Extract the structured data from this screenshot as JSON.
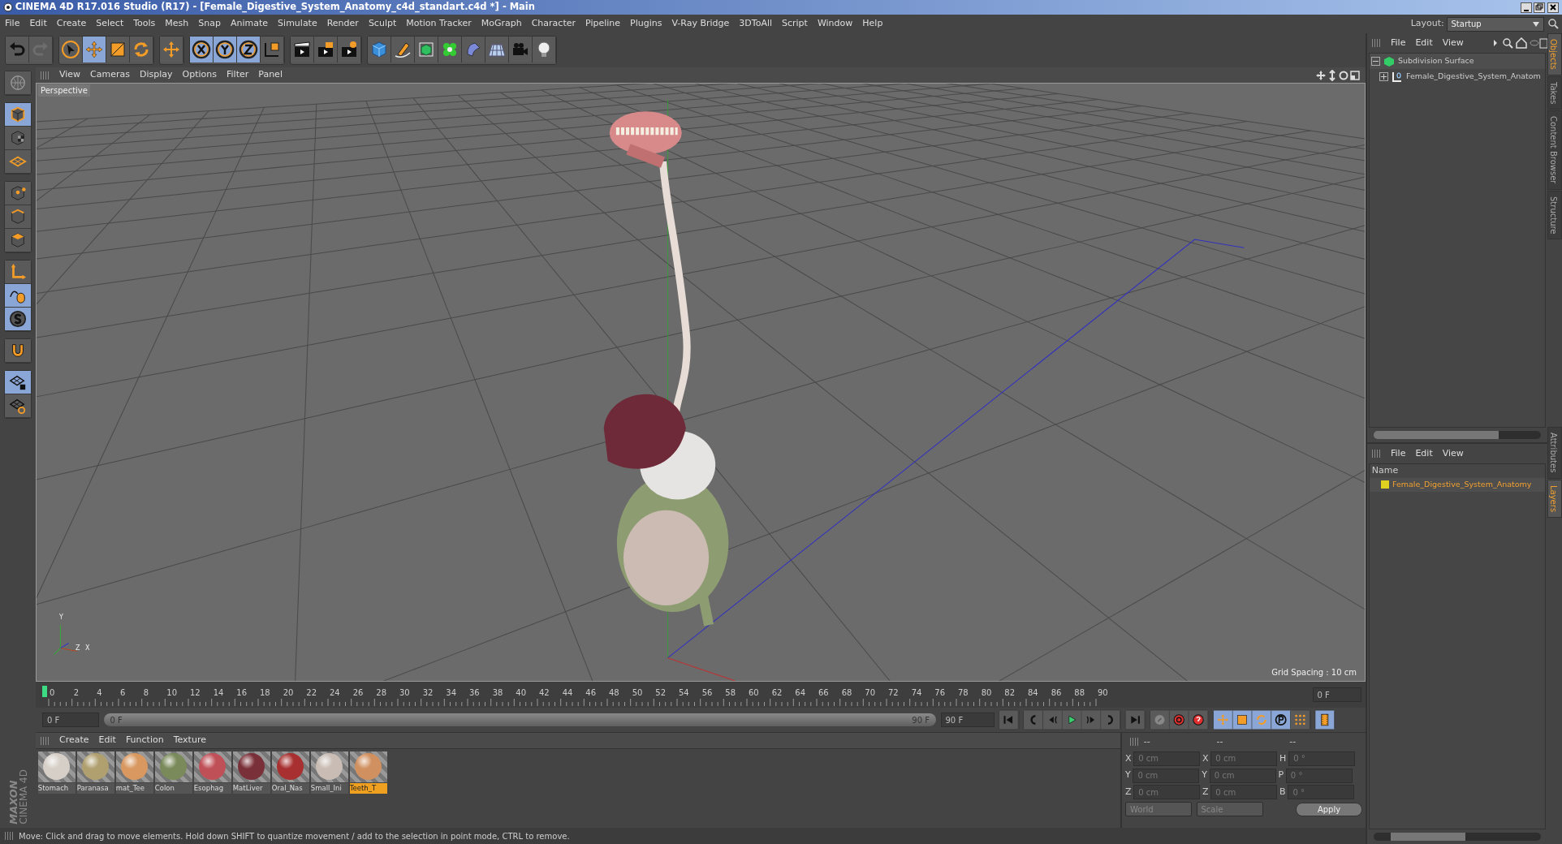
{
  "window": {
    "title": "CINEMA 4D R17.016 Studio (R17) - [Female_Digestive_System_Anatomy_c4d_standart.c4d *] - Main"
  },
  "menu": [
    "File",
    "Edit",
    "Create",
    "Select",
    "Tools",
    "Mesh",
    "Snap",
    "Animate",
    "Simulate",
    "Render",
    "Sculpt",
    "Motion Tracker",
    "MoGraph",
    "Character",
    "Pipeline",
    "Plugins",
    "V-Ray Bridge",
    "3DToAll",
    "Script",
    "Window",
    "Help"
  ],
  "layout": {
    "label": "Layout:",
    "value": "Startup"
  },
  "toolbar": [
    {
      "tools": [
        {
          "kind": "undo",
          "active": false,
          "disabled": false
        },
        {
          "kind": "redo",
          "active": false,
          "disabled": true
        }
      ]
    },
    {
      "tools": [
        {
          "kind": "select",
          "active": false,
          "disabled": false
        },
        {
          "kind": "move",
          "active": true,
          "disabled": false
        },
        {
          "kind": "scale",
          "active": false,
          "disabled": false
        },
        {
          "kind": "rotate",
          "active": false,
          "disabled": false
        }
      ]
    },
    {
      "tools": [
        {
          "kind": "transform",
          "active": false,
          "disabled": false
        }
      ]
    },
    {
      "tools": [
        {
          "kind": "xaxis",
          "active": true,
          "disabled": false
        },
        {
          "kind": "yaxis",
          "active": true,
          "disabled": false
        },
        {
          "kind": "zaxis",
          "active": true,
          "disabled": false
        },
        {
          "kind": "coords",
          "active": false,
          "disabled": false
        }
      ]
    },
    {
      "tools": [
        {
          "kind": "render",
          "active": false,
          "disabled": false
        },
        {
          "kind": "renderpic",
          "active": false,
          "disabled": false
        },
        {
          "kind": "rendersettings",
          "active": false,
          "disabled": false
        }
      ]
    },
    {
      "tools": [
        {
          "kind": "cube",
          "active": false,
          "disabled": false
        },
        {
          "kind": "pen",
          "active": false,
          "disabled": false
        },
        {
          "kind": "subdiv",
          "active": false,
          "disabled": false
        },
        {
          "kind": "cloner",
          "active": false,
          "disabled": false
        },
        {
          "kind": "deformer",
          "active": false,
          "disabled": false
        },
        {
          "kind": "floor",
          "active": false,
          "disabled": false
        },
        {
          "kind": "camera",
          "active": false,
          "disabled": false
        },
        {
          "kind": "light",
          "active": false,
          "disabled": false
        }
      ]
    }
  ],
  "palette": [
    {
      "tools": [
        {
          "kind": "globe",
          "active": false
        }
      ]
    },
    {
      "tools": [
        {
          "kind": "model",
          "active": true
        },
        {
          "kind": "texture",
          "active": false
        },
        {
          "kind": "workplane",
          "active": false
        }
      ]
    },
    {
      "tools": [
        {
          "kind": "points",
          "active": false
        },
        {
          "kind": "edges",
          "active": false
        },
        {
          "kind": "polygons",
          "active": false
        }
      ]
    },
    {
      "tools": [
        {
          "kind": "axis",
          "active": false
        },
        {
          "kind": "tweak",
          "active": true
        },
        {
          "kind": "snap",
          "active": true
        }
      ]
    },
    {
      "tools": [
        {
          "kind": "magnet",
          "active": false
        }
      ]
    },
    {
      "tools": [
        {
          "kind": "gridlock",
          "active": true
        },
        {
          "kind": "gridsync",
          "active": false
        }
      ]
    }
  ],
  "brand": [
    "MAXON",
    "CINEMA 4D"
  ],
  "viewport": {
    "menu": [
      "View",
      "Cameras",
      "Display",
      "Options",
      "Filter",
      "Panel"
    ],
    "camera": "Perspective",
    "grid_spacing": "Grid Spacing : 10 cm",
    "axis_labels": [
      "Y",
      "Z",
      "X"
    ]
  },
  "objects_panel": {
    "menu": [
      "File",
      "Edit",
      "View"
    ],
    "tree": [
      {
        "name": "Subdivision Surface",
        "kind": "subdivision",
        "expanded": true,
        "children": [
          {
            "name": "Female_Digestive_System_Anatom",
            "kind": "null",
            "expanded": false
          }
        ]
      }
    ]
  },
  "side_tabs_top": [
    {
      "label": "Objects",
      "selected": true
    },
    {
      "label": "Takes",
      "selected": false
    },
    {
      "label": "Content Browser",
      "selected": false
    },
    {
      "label": "Structure",
      "selected": false
    }
  ],
  "layers_panel": {
    "menu": [
      "File",
      "Edit",
      "View"
    ],
    "header": "Name",
    "rows": [
      {
        "name": "Female_Digestive_System_Anatomy",
        "color": "#e0d020"
      }
    ]
  },
  "side_tabs_bottom": [
    {
      "label": "Attributes",
      "selected": false
    },
    {
      "label": "Layers",
      "selected": true
    }
  ],
  "timeline": {
    "frames": [
      "0",
      "2",
      "4",
      "6",
      "8",
      "10",
      "12",
      "14",
      "16",
      "18",
      "20",
      "22",
      "24",
      "26",
      "28",
      "30",
      "32",
      "34",
      "36",
      "38",
      "40",
      "42",
      "44",
      "46",
      "48",
      "50",
      "52",
      "54",
      "56",
      "58",
      "60",
      "62",
      "64",
      "66",
      "68",
      "70",
      "72",
      "74",
      "76",
      "78",
      "80",
      "82",
      "84",
      "86",
      "88",
      "90"
    ],
    "current": "0 F",
    "start": "0 F",
    "range": {
      "start": "0 F",
      "end": "90 F",
      "level": 1
    },
    "end": "90 F"
  },
  "transport": [
    {
      "tools": [
        {
          "kind": "first",
          "active": false
        }
      ]
    },
    {
      "tools": [
        {
          "kind": "prevkey",
          "active": false
        },
        {
          "kind": "prevframe",
          "active": false
        },
        {
          "kind": "play",
          "active": false
        },
        {
          "kind": "nextframe",
          "active": false
        },
        {
          "kind": "nextkey",
          "active": false
        }
      ]
    },
    {
      "tools": [
        {
          "kind": "last",
          "active": false
        }
      ]
    },
    {
      "tools": [
        {
          "kind": "keylock",
          "active": false
        },
        {
          "kind": "record",
          "active": false
        },
        {
          "kind": "autokey",
          "active": false
        }
      ]
    },
    {
      "tools": [
        {
          "kind": "keymove",
          "active": true
        },
        {
          "kind": "keyscale",
          "active": true
        },
        {
          "kind": "keyrotate",
          "active": true
        },
        {
          "kind": "keyparam",
          "active": true
        },
        {
          "kind": "keypla",
          "active": false
        }
      ]
    },
    {
      "tools": [
        {
          "kind": "film",
          "active": true
        }
      ]
    }
  ],
  "materials": {
    "menu": [
      "Create",
      "Edit",
      "Function",
      "Texture"
    ],
    "items": [
      {
        "name": "Stomach",
        "color": "#d6cfc8",
        "selected": false
      },
      {
        "name": "Paranasa",
        "color": "#b0a070",
        "selected": false
      },
      {
        "name": "mat_Tee",
        "color": "#d89860",
        "selected": false
      },
      {
        "name": "Colon",
        "color": "#7a8a5a",
        "selected": false
      },
      {
        "name": "Esophag",
        "color": "#c05058",
        "selected": false
      },
      {
        "name": "MatLiver",
        "color": "#7a3038",
        "selected": false
      },
      {
        "name": "Oral_Nas",
        "color": "#a83030",
        "selected": false
      },
      {
        "name": "Small_Ini",
        "color": "#c8bcb4",
        "selected": false
      },
      {
        "name": "Teeth_T",
        "color": "#d09060",
        "selected": true
      }
    ]
  },
  "coordinates": {
    "headers": [
      "--",
      "--",
      "--"
    ],
    "rows": [
      {
        "pos_axis": "X",
        "position": "0 cm",
        "size_axis": "X",
        "size": "0 cm",
        "rot_axis": "H",
        "rotation": "0 °"
      },
      {
        "pos_axis": "Y",
        "position": "0 cm",
        "size_axis": "Y",
        "size": "0 cm",
        "rot_axis": "P",
        "rotation": "0 °"
      },
      {
        "pos_axis": "Z",
        "position": "0 cm",
        "size_axis": "Z",
        "size": "0 cm",
        "rot_axis": "B",
        "rotation": "0 °"
      }
    ],
    "mode": "World",
    "transform": "Scale",
    "apply": "Apply"
  },
  "status_bar": "Move: Click and drag to move elements. Hold down SHIFT to quantize movement / add to the selection in point mode, CTRL to remove."
}
